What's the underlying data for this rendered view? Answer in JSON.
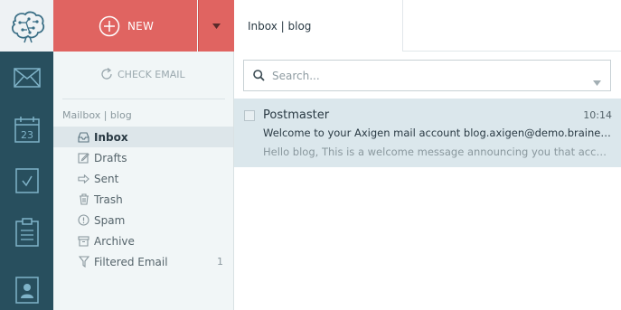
{
  "new_button": {
    "label": "NEW"
  },
  "check_email": {
    "label": "CHECK EMAIL"
  },
  "mailbox": {
    "title": "Mailbox | blog",
    "folders": [
      {
        "label": "Inbox",
        "icon": "inbox-icon",
        "active": true
      },
      {
        "label": "Drafts",
        "icon": "drafts-icon"
      },
      {
        "label": "Sent",
        "icon": "sent-icon"
      },
      {
        "label": "Trash",
        "icon": "trash-icon"
      },
      {
        "label": "Spam",
        "icon": "spam-icon"
      },
      {
        "label": "Archive",
        "icon": "archive-icon"
      },
      {
        "label": "Filtered Email",
        "icon": "filter-icon",
        "count": "1"
      }
    ]
  },
  "tab": {
    "label": "Inbox | blog"
  },
  "search": {
    "placeholder": "Search..."
  },
  "messages": [
    {
      "from": "Postmaster",
      "time": "10:14",
      "subject": "Welcome to your Axigen mail account blog.axigen@demo.braineering.ro",
      "preview": "Hello blog, This is a welcome message announcing you that account blog.axigen@demo.braineering.ro has been created."
    }
  ],
  "rail": {
    "items": [
      "mail-icon",
      "calendar-icon",
      "tasks-icon",
      "notes-icon",
      "contacts-icon"
    ],
    "calendar_day": "23"
  },
  "colors": {
    "rail": "#284f5e",
    "new_button": "#e06461",
    "folder_panel": "#f1f6f7",
    "selected_message": "#dbe7ec"
  }
}
